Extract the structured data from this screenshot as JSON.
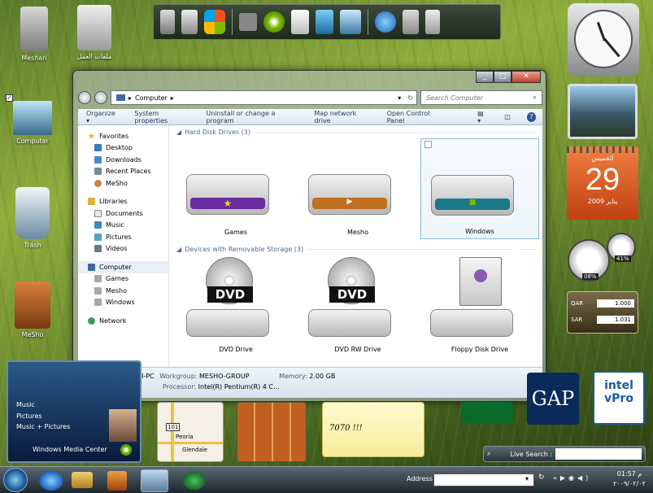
{
  "desktop_icons": [
    {
      "label": "Meshari",
      "icon": "user-folder-icon"
    },
    {
      "label": "ملفات العمل",
      "icon": "server-icon"
    },
    {
      "label": "Computer",
      "icon": "computer-icon"
    },
    {
      "label": "Trash",
      "icon": "recycle-bin-icon"
    },
    {
      "label": "MeSho",
      "icon": "user-briefcase-icon"
    }
  ],
  "window": {
    "address": {
      "path": "Computer",
      "search_placeholder": "Search Computer"
    },
    "toolbar": {
      "organize": "Organize",
      "system_properties": "System properties",
      "uninstall": "Uninstall or change a program",
      "map_drive": "Map network drive",
      "control_panel": "Open Control Panel"
    },
    "nav": {
      "favorites": "Favorites",
      "desktop": "Desktop",
      "downloads": "Downloads",
      "recent_places": "Recent Places",
      "mesho": "MeSho",
      "libraries": "Libraries",
      "documents": "Documents",
      "music": "Music",
      "pictures": "Pictures",
      "videos": "Videos",
      "computer": "Computer",
      "games": "Games",
      "mesho2": "Mesho",
      "windows": "Windows",
      "network": "Network"
    },
    "sections": {
      "hard_disk": "Hard Disk Drives (3)",
      "removable": "Devices with Removable Storage (3)"
    },
    "drives": [
      {
        "label": "Games",
        "band": "#6a2aa0"
      },
      {
        "label": "Mesho",
        "band": "#c07020"
      },
      {
        "label": "Windows",
        "band": "#1a7a8a"
      }
    ],
    "removable": [
      {
        "label": "DVD Drive",
        "badge": "DVD"
      },
      {
        "label": "DVD RW Drive",
        "badge": "DVD"
      },
      {
        "label": "Floppy Disk Drive"
      }
    ],
    "details": {
      "pc_name": "MESHARI-PC",
      "workgroup_label": "Workgroup:",
      "workgroup": "MESHO-GROUP",
      "memory_label": "Memory:",
      "memory": "2.00 GB",
      "processor_label": "Processor:",
      "processor": "Intel(R) Pentium(R) 4 C..."
    }
  },
  "gadgets": {
    "calendar_day": "الخميس",
    "calendar_date": "29",
    "calendar_month": "يناير 2009",
    "cpu_value": "08%",
    "mem_value": "41%",
    "currency": [
      {
        "code": "QAR",
        "value": "1.000"
      },
      {
        "code": "SAR",
        "value": "1.031"
      }
    ],
    "media_center_items": [
      "Music",
      "Pictures",
      "Music + Pictures"
    ],
    "media_center_title": "Windows Media Center",
    "note_text": "7070 !!!",
    "map_labels": [
      "Peoria",
      "Glendale",
      "101"
    ],
    "live_search": "Live Search :",
    "intel": "intel",
    "vpro": "vPro",
    "gap": "GAP"
  },
  "taskbar": {
    "address_label": "Address",
    "time": "01:57 م",
    "date": "٢٠٠٩/٠٢/٠٢"
  }
}
